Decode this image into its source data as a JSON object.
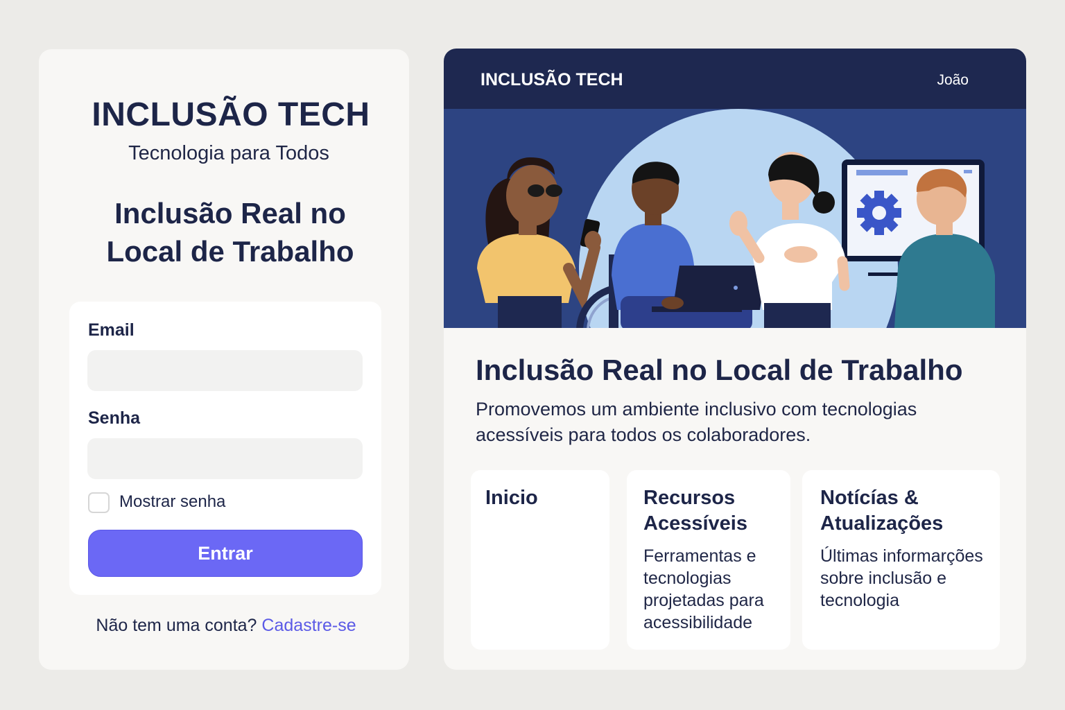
{
  "login": {
    "brand": "INCLUSÃO TECH",
    "tagline": "Tecnologia para Todos",
    "heading": "Inclusão Real no Local de Trabalho",
    "email_label": "Email",
    "email_value": "",
    "password_label": "Senha",
    "password_value": "",
    "show_password_label": "Mostrar senha",
    "submit_label": "Entrar",
    "signup_prompt": "Não tem uma conta?",
    "signup_link": "Cadastre-se"
  },
  "app": {
    "brand": "INCLUSÃO TECH",
    "user": "João",
    "hero_title": "Inclusão Real no Local de Trabalho",
    "hero_description": "Promovemos um ambiente inclusivo com tecnologias acessíveis para todos os colaboradores.",
    "nav_cards": [
      {
        "title": "Inicio",
        "description": ""
      },
      {
        "title": "Recursos Acessíveis",
        "description": "Ferramentas e tecnologias projetadas para acessibilidade"
      },
      {
        "title": "Notícías & Atualizações",
        "description": "Últimas informarções sobre inclusão e tecnologia"
      }
    ]
  },
  "colors": {
    "accent": "#6b68f5",
    "header": "#1e2850",
    "hero_bg": "#2d4482",
    "link": "#5b5ae6"
  }
}
